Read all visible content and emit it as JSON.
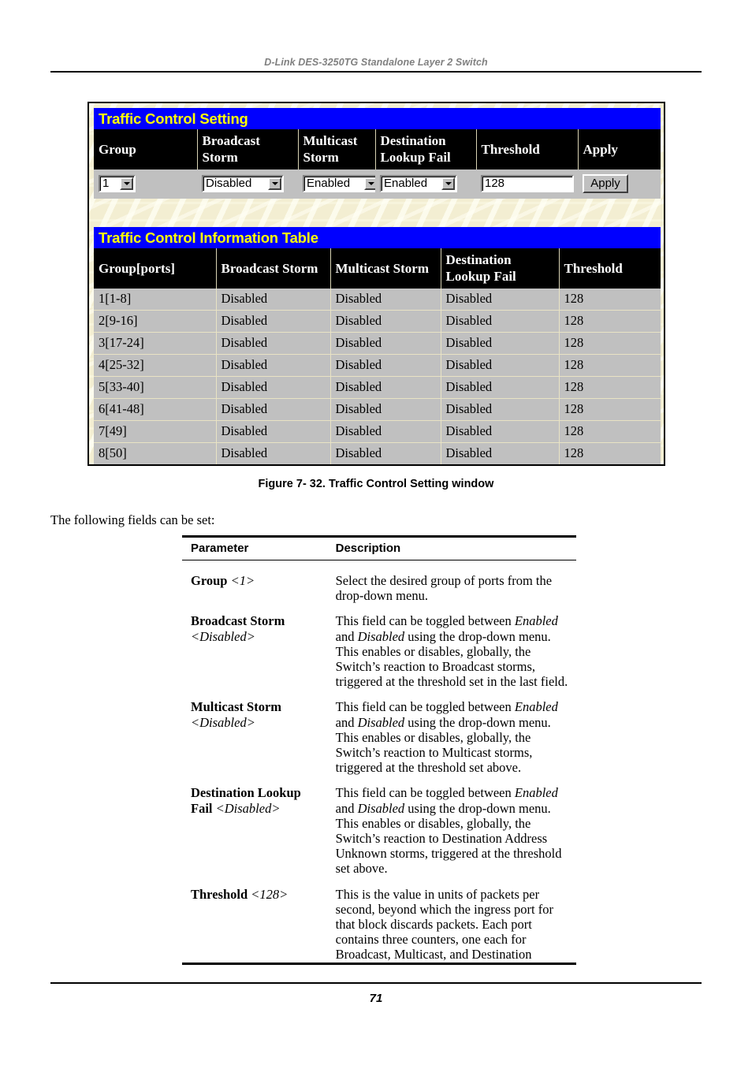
{
  "header": {
    "running_title": "D-Link DES-3250TG Standalone Layer 2 Switch"
  },
  "footer": {
    "page_number": "71"
  },
  "figure": {
    "caption": "Figure 7- 32.  Traffic Control Setting window"
  },
  "intro": {
    "text": "The following fields can be set:"
  },
  "screenshot": {
    "setting_panel": {
      "title": "Traffic Control Setting",
      "columns": [
        "Group",
        "Broadcast Storm",
        "Multicast Storm",
        "Destination Lookup Fail",
        "Threshold",
        "Apply"
      ],
      "columns_wrapped": [
        [
          "Group",
          ""
        ],
        [
          "Broadcast",
          "Storm"
        ],
        [
          "Multicast",
          "Storm"
        ],
        [
          "Destination",
          "Lookup Fail"
        ],
        [
          "Threshold",
          ""
        ],
        [
          "Apply",
          ""
        ]
      ],
      "controls": {
        "group_value": "1",
        "broadcast_storm_value": "Disabled",
        "multicast_storm_value": "Enabled",
        "destination_lookup_fail_value": "Enabled",
        "threshold_value": "128",
        "apply_label": "Apply"
      }
    },
    "info_table": {
      "title": "Traffic Control Information Table",
      "columns": [
        "Group[ports]",
        "Broadcast Storm",
        "Multicast Storm",
        "Destination Lookup Fail",
        "Threshold"
      ],
      "columns_wrapped": [
        [
          "Group[ports]",
          ""
        ],
        [
          "Broadcast Storm",
          ""
        ],
        [
          "Multicast Storm",
          ""
        ],
        [
          "Destination",
          "Lookup Fail"
        ],
        [
          "Threshold",
          ""
        ]
      ],
      "rows": [
        {
          "group": "1[1-8]",
          "broadcast": "Disabled",
          "multicast": "Disabled",
          "dlf": "Disabled",
          "threshold": "128"
        },
        {
          "group": "2[9-16]",
          "broadcast": "Disabled",
          "multicast": "Disabled",
          "dlf": "Disabled",
          "threshold": "128"
        },
        {
          "group": "3[17-24]",
          "broadcast": "Disabled",
          "multicast": "Disabled",
          "dlf": "Disabled",
          "threshold": "128"
        },
        {
          "group": "4[25-32]",
          "broadcast": "Disabled",
          "multicast": "Disabled",
          "dlf": "Disabled",
          "threshold": "128"
        },
        {
          "group": "5[33-40]",
          "broadcast": "Disabled",
          "multicast": "Disabled",
          "dlf": "Disabled",
          "threshold": "128"
        },
        {
          "group": "6[41-48]",
          "broadcast": "Disabled",
          "multicast": "Disabled",
          "dlf": "Disabled",
          "threshold": "128"
        },
        {
          "group": "7[49]",
          "broadcast": "Disabled",
          "multicast": "Disabled",
          "dlf": "Disabled",
          "threshold": "128"
        },
        {
          "group": "8[50]",
          "broadcast": "Disabled",
          "multicast": "Disabled",
          "dlf": "Disabled",
          "threshold": "128"
        }
      ]
    },
    "colors": {
      "title_bar_bg": "#0000ff",
      "title_bar_text": "#ffff00",
      "table_header_bg": "#000000",
      "table_header_text": "#ffffff",
      "row_bg": "#c0c0c0",
      "page_bg": "#f3eed2"
    }
  },
  "param_table": {
    "headers": {
      "parameter": "Parameter",
      "description": "Description"
    },
    "rows": [
      {
        "name_plain": "Group",
        "name_value": "<1>",
        "description": "Select the desired group of ports from the drop-down menu."
      },
      {
        "name_plain": "Broadcast Storm",
        "name_value": "<Disabled>",
        "description": "This field can be toggled between Enabled and Disabled using the drop-down menu. This enables or disables, globally, the Switch’s reaction to Broadcast storms, triggered at the threshold set in the last field."
      },
      {
        "name_plain": "Multicast Storm",
        "name_value": "<Disabled>",
        "description": "This field can be toggled between Enabled and Disabled using the drop-down menu. This enables or disables, globally, the Switch’s reaction to Multicast storms, triggered at the threshold set above."
      },
      {
        "name_plain": "Destination Lookup Fail",
        "name_value": "<Disabled>",
        "description": "This field can be toggled between Enabled and Disabled using the drop-down menu. This enables or disables, globally, the Switch’s reaction to Destination Address Unknown storms, triggered at the threshold set above."
      },
      {
        "name_plain": "Threshold",
        "name_value": "<128>",
        "description": "This is the value in units of packets per second, beyond which the ingress port for that block discards packets. Each port contains three counters, one each for Broadcast, Multicast, and Destination"
      }
    ]
  }
}
